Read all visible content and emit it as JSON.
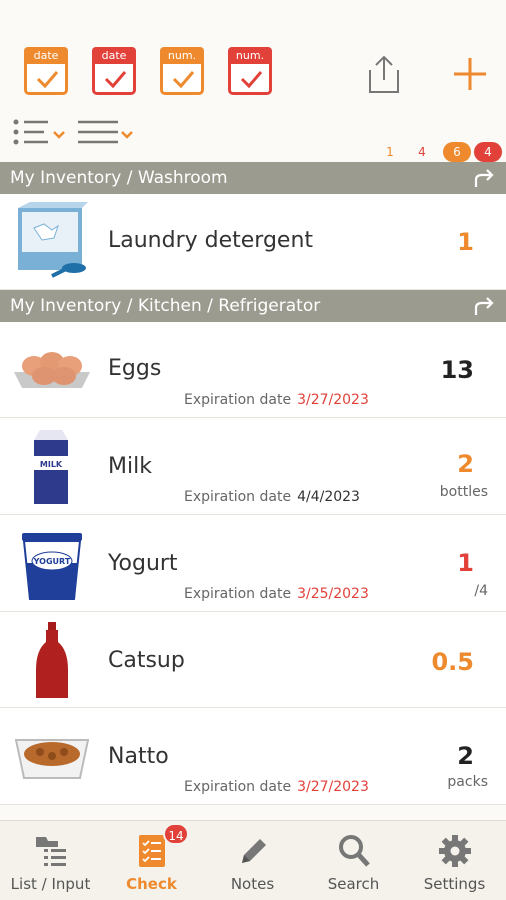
{
  "toolbar": {
    "filters": [
      {
        "label": "date",
        "color": "#ee8a2d",
        "icon": "calendar-check-icon"
      },
      {
        "label": "date",
        "color": "#e2413a",
        "icon": "calendar-check-icon"
      },
      {
        "label": "num.",
        "color": "#ee8a2d",
        "icon": "calendar-check-icon"
      },
      {
        "label": "num.",
        "color": "#e2413a",
        "icon": "calendar-check-icon"
      }
    ],
    "share_icon": "share-icon",
    "add_icon": "plus-icon"
  },
  "view_options": {
    "list_style_icon": "list-bullets-dropdown-icon",
    "sort_icon": "list-lines-dropdown-icon"
  },
  "counts": {
    "orange_date": "1",
    "red_date": "4",
    "orange_num": "6",
    "red_num": "4"
  },
  "sections": [
    {
      "title": "My Inventory / Washroom",
      "items": [
        {
          "name": "Laundry detergent",
          "quantity": "1",
          "quantity_color": "orange",
          "unit": "",
          "expiration_label": "",
          "expiration_date": "",
          "image": "detergent-image"
        }
      ]
    },
    {
      "title": "My Inventory / Kitchen / Refrigerator",
      "items": [
        {
          "name": "Eggs",
          "quantity": "13",
          "quantity_color": "black",
          "unit": "",
          "expiration_label": "Expiration date",
          "expiration_date": "3/27/2023",
          "date_color": "red",
          "image": "eggs-image"
        },
        {
          "name": "Milk",
          "quantity": "2",
          "quantity_color": "orange",
          "unit": "bottles",
          "expiration_label": "Expiration date",
          "expiration_date": "4/4/2023",
          "date_color": "normal",
          "image": "milk-image"
        },
        {
          "name": "Yogurt",
          "quantity": "1",
          "quantity_color": "red",
          "unit": "/4",
          "expiration_label": "Expiration date",
          "expiration_date": "3/25/2023",
          "date_color": "red",
          "image": "yogurt-image"
        },
        {
          "name": "Catsup",
          "quantity": "0.5",
          "quantity_color": "orange",
          "unit": "",
          "expiration_label": "",
          "expiration_date": "",
          "image": "catsup-image"
        },
        {
          "name": "Natto",
          "quantity": "2",
          "quantity_color": "black",
          "unit": "packs",
          "expiration_label": "Expiration date",
          "expiration_date": "3/27/2023",
          "date_color": "red",
          "image": "natto-image"
        }
      ]
    }
  ],
  "nav": {
    "tabs": [
      {
        "label": "List / Input",
        "icon": "list-input-icon",
        "active": false
      },
      {
        "label": "Check",
        "icon": "checklist-icon",
        "active": true,
        "badge": "14"
      },
      {
        "label": "Notes",
        "icon": "pencil-icon",
        "active": false
      },
      {
        "label": "Search",
        "icon": "search-icon",
        "active": false
      },
      {
        "label": "Settings",
        "icon": "gear-icon",
        "active": false
      }
    ]
  },
  "colors": {
    "accent_orange": "#ee8a2d",
    "accent_red": "#e2413a",
    "section_bg": "#9c9b90",
    "background": "#fbfaf6"
  }
}
